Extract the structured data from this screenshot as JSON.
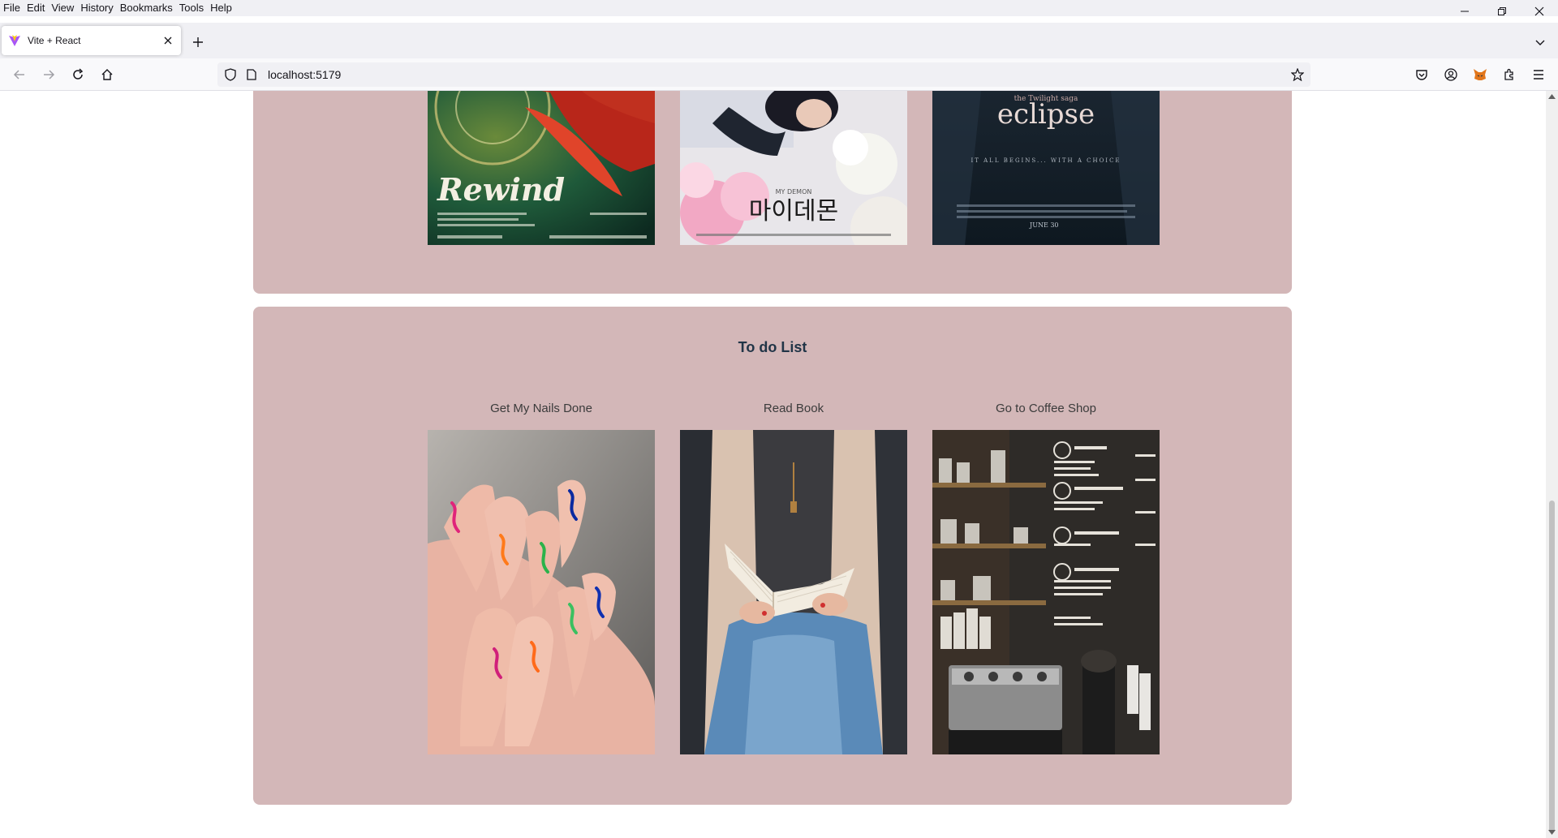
{
  "menu": [
    "File",
    "Edit",
    "View",
    "History",
    "Bookmarks",
    "Tools",
    "Help"
  ],
  "tab": {
    "title": "Vite + React"
  },
  "address": {
    "url": "localhost:5179"
  },
  "movies": [
    {
      "title": "Rewind"
    },
    {
      "title": "마이데몬",
      "subtitle": "MY DEMON"
    },
    {
      "title": "eclipse",
      "series": "the Twilight saga",
      "tagline": "IT ALL BEGINS... WITH A CHOICE",
      "date": "JUNE 30"
    }
  ],
  "todo": {
    "heading": "To do List",
    "items": [
      {
        "label": "Get My Nails Done"
      },
      {
        "label": "Read Book"
      },
      {
        "label": "Go to Coffee Shop"
      }
    ]
  },
  "colors": {
    "card": "#d3b7b8",
    "heading": "#213547"
  }
}
